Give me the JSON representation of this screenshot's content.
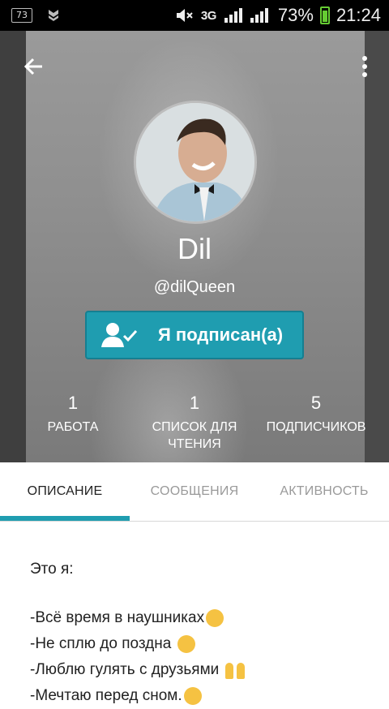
{
  "status_bar": {
    "notification_count": "73",
    "network": "3G",
    "battery": "73%",
    "time": "21:24"
  },
  "profile": {
    "name": "Dil",
    "handle": "@dilQueen",
    "follow_label": "Я подписан(а)"
  },
  "stats": [
    {
      "value": "1",
      "label": "РАБОТА"
    },
    {
      "value": "1",
      "label": "СПИСОК ДЛЯ ЧТЕНИЯ"
    },
    {
      "value": "5",
      "label": "ПОДПИСЧИКОВ"
    }
  ],
  "tabs": [
    {
      "label": "ОПИСАНИЕ",
      "active": true
    },
    {
      "label": "СООБЩЕНИЯ",
      "active": false
    },
    {
      "label": "АКТИВНОСТЬ",
      "active": false
    }
  ],
  "description": {
    "lines": [
      "Это я:",
      "-Всё время в наушниках",
      "-Не сплю до поздна ",
      "-Люблю гулять с друзьями ",
      "-Мечтаю перед сном."
    ]
  },
  "colors": {
    "accent": "#1f9db0",
    "header_bg": "#8f8f8f"
  },
  "icons": {
    "back": "arrow-left-icon",
    "more": "more-vertical-icon",
    "follow": "user-check-icon"
  }
}
